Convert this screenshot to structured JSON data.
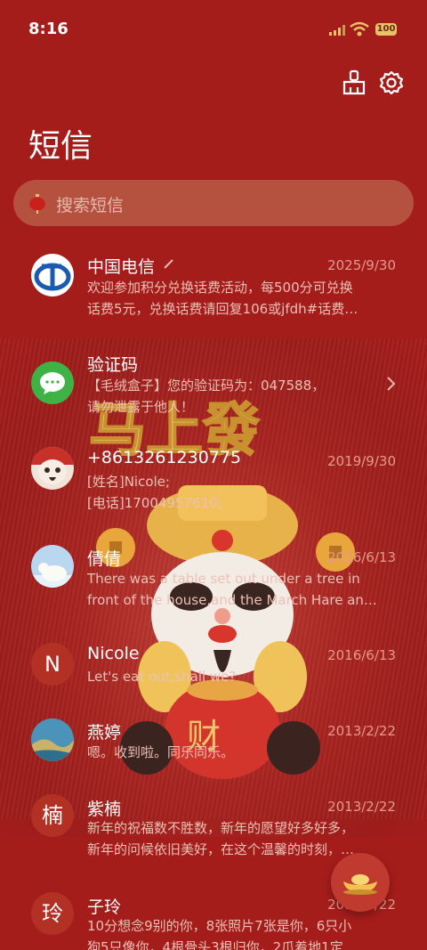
{
  "status": {
    "time": "8:16",
    "battery": "100"
  },
  "header": {
    "title": "短信"
  },
  "search": {
    "placeholder": "搜索短信"
  },
  "conversations": [
    {
      "name": "中国电信",
      "date": "2025/9/30",
      "line1": "欢迎参加积分兑换话费活动，每500分可兑换",
      "line2": "话费5元，兑换话费请回复106或jfdh#话费…",
      "avatar": "china-telecom-logo"
    },
    {
      "name": "验证码",
      "date": "",
      "line1": "【毛绒盒子】您的验证码为：047588，",
      "line2": "请勿泄露于他人！",
      "avatar": "message-logo"
    },
    {
      "name": "+8613261230775",
      "date": "2019/9/30",
      "line1": "[姓名]Nicole;",
      "line2": "[电话]17004957610;",
      "avatar": "fortune-god-avatar"
    },
    {
      "name": "倩倩",
      "date": "2016/6/13",
      "line1": "There was a table set out under a tree in",
      "line2": "front of the house,and the March Hare an…",
      "avatar": "polar-bear-avatar"
    },
    {
      "name": "Nicole",
      "date": "2016/6/13",
      "line1": "Let's eat out,shall we?",
      "line2": "",
      "avatar": "N"
    },
    {
      "name": "燕婷",
      "date": "2013/2/22",
      "line1": "嗯。收到啦。同乐同乐。",
      "line2": "",
      "avatar": "landscape-avatar"
    },
    {
      "name": "紫楠",
      "date": "2013/2/22",
      "line1": "新年的祝福数不胜数，新年的愿望好多好多，",
      "line2": "新年的问候依旧美好，在这个温馨的时刻，…",
      "avatar": "楠"
    },
    {
      "name": "子玲",
      "date": "2013/2/22",
      "line1": "10分想念9别的你，8张照片7张是你，6只小",
      "line2": "狗5只像你，4根骨头3根归你，2爪着地1定",
      "avatar": "玲"
    }
  ],
  "decoration": {
    "banner_text": "马上發",
    "bag_text": "财"
  },
  "colors": {
    "background": "#a51d1b",
    "search_bg": "#b4513f",
    "date": "#e49a8d",
    "snippet": "#ecc0b6"
  }
}
